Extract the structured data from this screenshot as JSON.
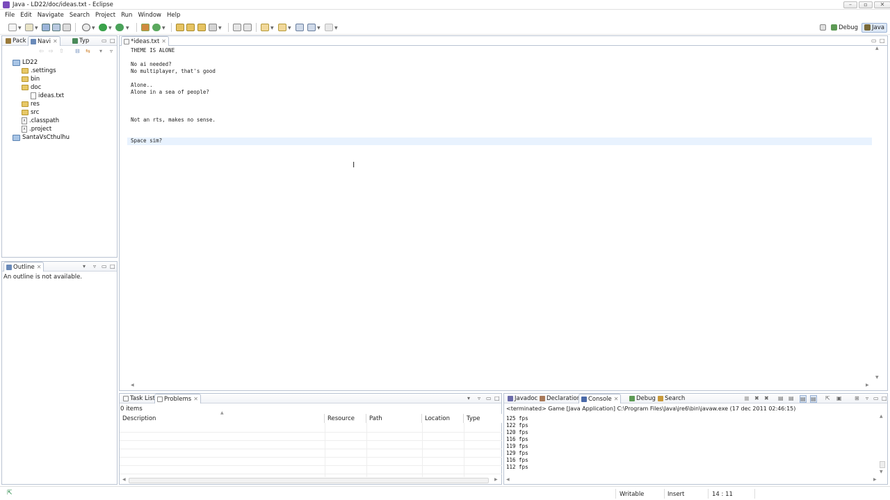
{
  "window": {
    "title": "Java - LD22/doc/ideas.txt - Eclipse"
  },
  "menu": [
    "File",
    "Edit",
    "Navigate",
    "Search",
    "Project",
    "Run",
    "Window",
    "Help"
  ],
  "perspectives": [
    {
      "label": "Debug",
      "icon": "debug-perspective-icon",
      "active": false
    },
    {
      "label": "Java",
      "icon": "java-perspective-icon",
      "active": true
    }
  ],
  "left_tabs": [
    {
      "label": "Pack",
      "icon": "package-explorer-icon"
    },
    {
      "label": "Navi",
      "icon": "navigator-icon"
    },
    {
      "label": "Typ",
      "icon": "type-hierarchy-icon"
    }
  ],
  "tree": [
    {
      "label": "LD22",
      "kind": "project",
      "level": 0
    },
    {
      "label": ".settings",
      "kind": "folder",
      "level": 1
    },
    {
      "label": "bin",
      "kind": "folder",
      "level": 1
    },
    {
      "label": "doc",
      "kind": "folder",
      "level": 1
    },
    {
      "label": "ideas.txt",
      "kind": "file",
      "level": 2
    },
    {
      "label": "res",
      "kind": "folder",
      "level": 1
    },
    {
      "label": "src",
      "kind": "folder",
      "level": 1
    },
    {
      "label": ".classpath",
      "kind": "xfile",
      "level": 1
    },
    {
      "label": ".project",
      "kind": "xfile",
      "level": 1
    },
    {
      "label": "SantaVsCthulhu",
      "kind": "project",
      "level": 0
    }
  ],
  "outline": {
    "tab": "Outline",
    "message": "An outline is not available."
  },
  "editor": {
    "tab": "*ideas.txt",
    "lines": [
      "THEME IS ALONE",
      "",
      "No ai needed?",
      "No multiplayer, that's good",
      "",
      "Alone..",
      "Alone in a sea of people?",
      "",
      "",
      "",
      "Not an rts, makes no sense.",
      "",
      "",
      "Space sim?"
    ]
  },
  "problems": {
    "tabs": [
      "Task List",
      "Problems"
    ],
    "count": "0 items",
    "columns": [
      "Description",
      "Resource",
      "Path",
      "Location",
      "Type"
    ]
  },
  "console": {
    "tabs": [
      "Javadoc",
      "Declaration",
      "Console",
      "Debug",
      "Search"
    ],
    "header": "<terminated> Game [Java Application] C:\\Program Files\\Java\\jre6\\bin\\javaw.exe (17 dec 2011 02:46:15)",
    "lines": [
      "125 fps",
      "122 fps",
      "120 fps",
      "116 fps",
      "119 fps",
      "129 fps",
      "116 fps",
      "112 fps"
    ]
  },
  "status": {
    "writable": "Writable",
    "mode": "Insert",
    "position": "14 : 11"
  }
}
